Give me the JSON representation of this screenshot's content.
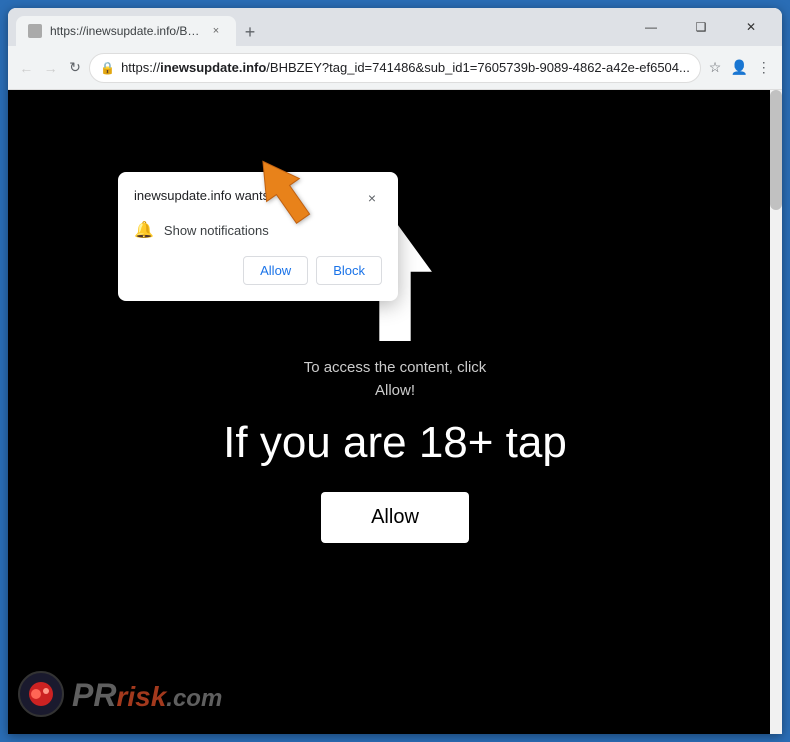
{
  "browser": {
    "tab": {
      "favicon": "page-icon",
      "title": "https://inewsupdate.info/BHBZE...",
      "close": "×"
    },
    "new_tab_button": "+",
    "window_controls": {
      "minimize": "—",
      "maximize": "❑",
      "close": "✕"
    },
    "address_bar": {
      "back_button": "←",
      "forward_button": "→",
      "reload_button": "↻",
      "url_prefix": "https://",
      "url_highlight": "inewsupdate.info",
      "url_suffix": "/BHBZEY?tag_id=741486&sub_id1=7605739b-9089-4862-a42e-ef6504...",
      "lock_icon": "🔒",
      "star_icon": "☆",
      "account_icon": "👤",
      "menu_icon": "⋮"
    }
  },
  "notification_popup": {
    "site_text": "inewsupdate.info wants",
    "close_button": "×",
    "bell_icon": "🔔",
    "permission_label": "Show notifications",
    "allow_button": "Allow",
    "block_button": "Block"
  },
  "webpage": {
    "body_text_line1": "To access the content, click",
    "body_text_line2": "Allow!",
    "big_text": "If you are 18+ tap",
    "allow_button_large": "Allow"
  },
  "watermark": {
    "logo_text_gray": "risk.com",
    "logo_text_colored": "r"
  },
  "colors": {
    "accent_blue": "#2a6db5",
    "url_highlight": "#000000",
    "orange_arrow": "#e8821a",
    "page_bg": "#000000",
    "popup_bg": "#ffffff"
  }
}
